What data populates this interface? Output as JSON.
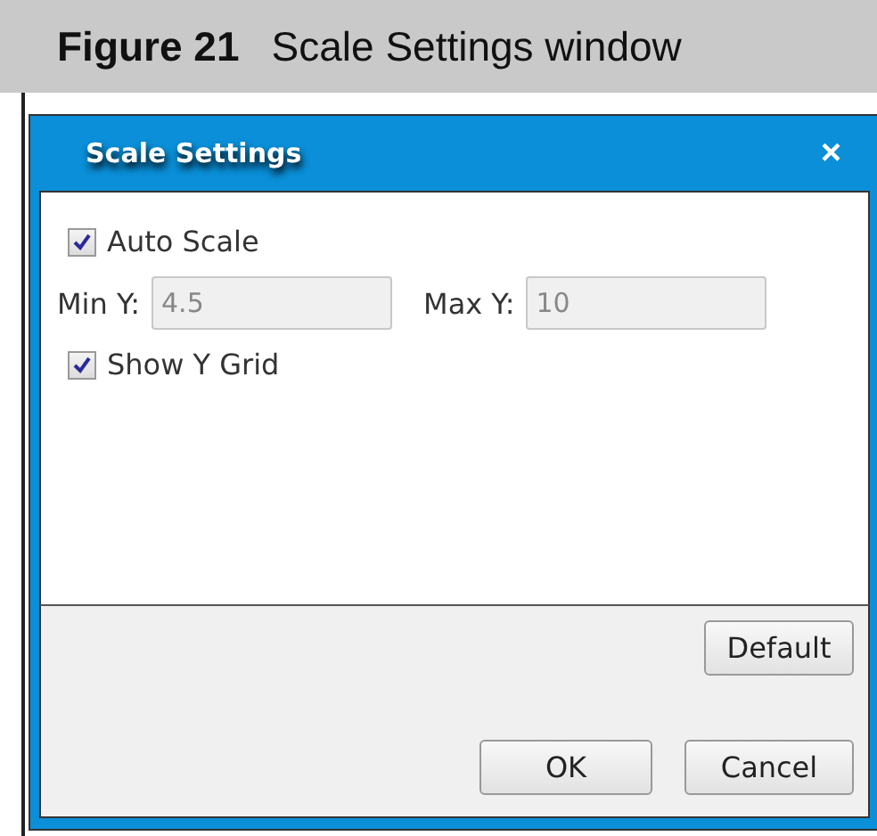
{
  "caption": {
    "label": "Figure 21",
    "title": "Scale Settings window"
  },
  "window": {
    "title": "Scale Settings",
    "close": "×"
  },
  "auto_scale": {
    "label": "Auto Scale",
    "checked": true
  },
  "fields": [
    {
      "label": "Min Y:",
      "value": "4.5",
      "disabled": true
    },
    {
      "label": "Max Y:",
      "value": "10",
      "disabled": true
    }
  ],
  "show_grid": {
    "label": "Show Y Grid",
    "checked": true
  },
  "default_button": "Default",
  "buttons": [
    "OK",
    "Cancel"
  ]
}
